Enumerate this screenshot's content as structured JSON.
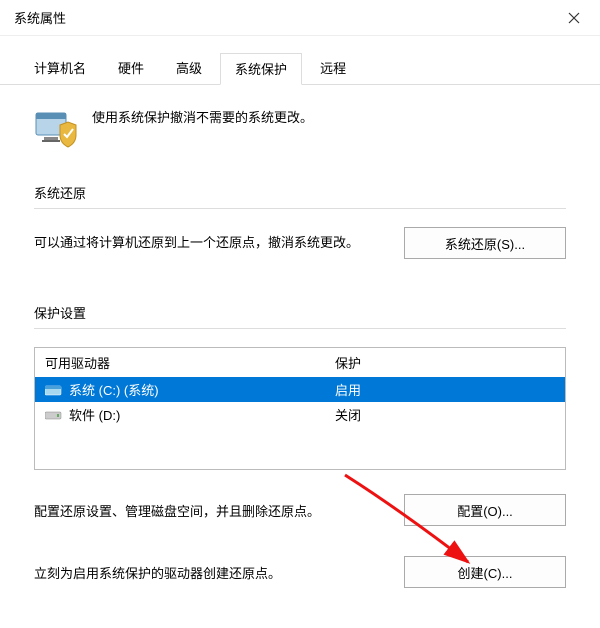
{
  "window": {
    "title": "系统属性"
  },
  "tabs": {
    "items": [
      "计算机名",
      "硬件",
      "高级",
      "系统保护",
      "远程"
    ],
    "active": 3
  },
  "intro": {
    "text": "使用系统保护撤消不需要的系统更改。"
  },
  "restore": {
    "header": "系统还原",
    "text": "可以通过将计算机还原到上一个还原点，撤消系统更改。",
    "button": "系统还原(S)..."
  },
  "settings": {
    "header": "保护设置",
    "cols": {
      "drive": "可用驱动器",
      "protection": "保护"
    },
    "rows": [
      {
        "icon": "drive-c",
        "label": "系统 (C:) (系统)",
        "protection": "启用",
        "selected": true
      },
      {
        "icon": "drive-d",
        "label": "软件 (D:)",
        "protection": "关闭",
        "selected": false
      }
    ]
  },
  "configure": {
    "text": "配置还原设置、管理磁盘空间，并且删除还原点。",
    "button": "配置(O)..."
  },
  "create": {
    "text": "立刻为启用系统保护的驱动器创建还原点。",
    "button": "创建(C)..."
  }
}
